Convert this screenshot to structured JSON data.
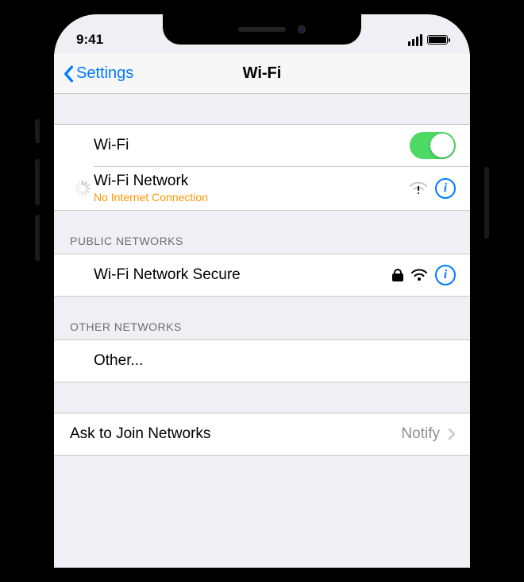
{
  "status": {
    "time": "9:41"
  },
  "nav": {
    "back_label": "Settings",
    "title": "Wi-Fi"
  },
  "wifi_toggle": {
    "label": "Wi-Fi",
    "on": true
  },
  "current_network": {
    "name": "Wi-Fi Network",
    "status_message": "No Internet Connection"
  },
  "sections": {
    "public": {
      "header": "PUBLIC NETWORKS",
      "networks": [
        {
          "name": "Wi-Fi Network Secure",
          "secured": true
        }
      ]
    },
    "other": {
      "header": "OTHER NETWORKS",
      "other_label": "Other..."
    }
  },
  "ask_to_join": {
    "label": "Ask to Join Networks",
    "value": "Notify"
  },
  "colors": {
    "accent": "#007aff",
    "warning": "#ff9500",
    "toggle_on": "#4cd964"
  }
}
